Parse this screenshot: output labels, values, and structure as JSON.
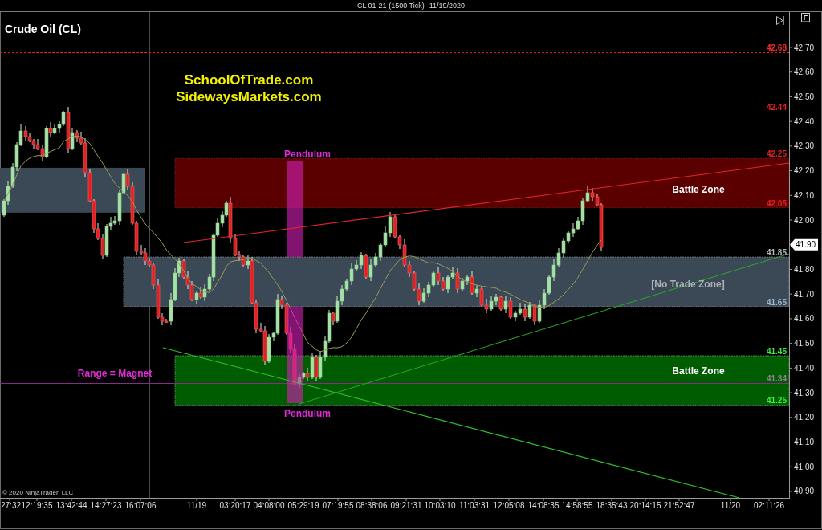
{
  "chart_header": {
    "instrument": "CL 01-21 (1500 Tick)",
    "date": "11/19/2020"
  },
  "toolbar": {
    "button_label": "F"
  },
  "chart_title": "Crude Oil (CL)",
  "branding_text": [
    "SchoolOfTrade.com",
    "SidewaysMarkets.com"
  ],
  "levels": [
    {
      "kind": "dashed",
      "price": "42.68",
      "color": "#e01e1e"
    },
    {
      "kind": "solid",
      "price": "42.44",
      "color": "#7a1818"
    },
    {
      "kind": "magnet",
      "price": "41.34",
      "label": "Range = Magnet",
      "color": "#8a2a8a"
    }
  ],
  "zones": [
    {
      "kind": "plain",
      "color": "#3a4955"
    },
    {
      "kind": "battle",
      "label": "Battle Zone",
      "top_price": "42.25",
      "bottom_price": "42.05",
      "color": "#5a0000"
    },
    {
      "kind": "no_trade",
      "label": "[No Trade Zone]",
      "top_price": "41.85",
      "bottom_price": "41.65",
      "color": "#3a4955"
    },
    {
      "kind": "battle",
      "label": "Battle Zone",
      "top_price": "41.45",
      "bottom_price": "41.25",
      "color": "#005c00"
    }
  ],
  "pendulums": [
    {
      "label": "Pendulum"
    },
    {
      "label": "Pendulum"
    }
  ],
  "price_axis": {
    "labels": [
      "42.70",
      "42.60",
      "42.50",
      "42.40",
      "42.30",
      "42.20",
      "42.10",
      "42.00",
      "41.80",
      "41.70",
      "41.60",
      "41.50",
      "41.40",
      "41.30",
      "41.20",
      "41.10",
      "41.00",
      "40.90"
    ],
    "current_price": "41.90"
  },
  "time_axis": {
    "labels": [
      "27:32",
      "12:19:35",
      "13:42:44",
      "14:27:23",
      "16:07:06",
      "11/19",
      "03:20:17",
      "04:08:00",
      "05:29:19",
      "07:19:55",
      "08:38:06",
      "09:21:31",
      "10:03:10",
      "11:03:31",
      "12:05:08",
      "14:08:35",
      "14:58:55",
      "18:35:43",
      "20:14:15",
      "21:52:47",
      "11/20",
      "02:11:26"
    ]
  },
  "copyright": "© 2020 NinjaTrader, LLC"
}
